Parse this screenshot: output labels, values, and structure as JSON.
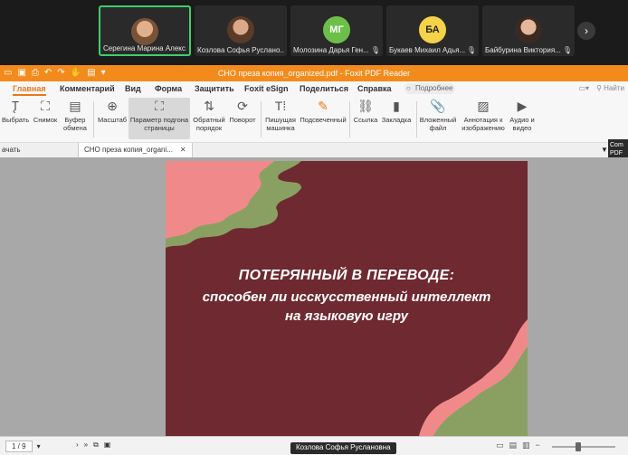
{
  "participants": [
    {
      "name": "Серегина Марина Алекс...",
      "initials": "",
      "avatar_color": "#7a5236",
      "active": true
    },
    {
      "name": "Козлова Софья Руслано...",
      "initials": "",
      "avatar_color": "#5a3b28",
      "active": false
    },
    {
      "name": "Молозина Дарья Ген...",
      "initials": "МГ",
      "avatar_color": "#6cc04a",
      "active": false
    },
    {
      "name": "Букаев Михаил Адья...",
      "initials": "БА",
      "avatar_color": "#f4d24a",
      "active": false
    },
    {
      "name": "Байбурина Виктория...",
      "initials": "",
      "avatar_color": "#3a2a22",
      "active": false
    }
  ],
  "next_icon": "chevron-right",
  "window_title": "СНО преза копия_organized.pdf - Foxit PDF Reader",
  "ribbon_tabs": [
    "Главная",
    "Комментарий",
    "Вид",
    "Форма",
    "Защитить",
    "Foxit eSign",
    "Поделиться",
    "Справка"
  ],
  "search_tip": "Подробнее",
  "find_label": "Найти",
  "tools": [
    {
      "label": "Выбрать",
      "icon": "text-cursor-icon"
    },
    {
      "label": "Снимок",
      "icon": "camera-icon"
    },
    {
      "label": "Буфер обмена",
      "icon": "clipboard-icon"
    },
    {
      "label": "Масштаб",
      "icon": "zoom-icon"
    },
    {
      "label": "Параметр подгона страницы",
      "icon": "fit-page-icon"
    },
    {
      "label": "Обратный порядок",
      "icon": "reverse-order-icon"
    },
    {
      "label": "Поворот",
      "icon": "rotate-icon"
    },
    {
      "label": "Пишущая машинка",
      "icon": "typewriter-icon"
    },
    {
      "label": "Подсвеченный",
      "icon": "highlight-icon"
    },
    {
      "label": "Ссылка",
      "icon": "link-icon"
    },
    {
      "label": "Закладка",
      "icon": "bookmark-icon"
    },
    {
      "label": "Вложенный файл",
      "icon": "attach-file-icon"
    },
    {
      "label": "Аннотация к изображению",
      "icon": "image-annotation-icon"
    },
    {
      "label": "Аудио и видео",
      "icon": "media-icon"
    }
  ],
  "doc_tabs": {
    "start": "ачать",
    "current": "СНО преза копия_organi..."
  },
  "side_note": "Com PDF",
  "slide": {
    "title": "ПОТЕРЯННЫЙ В ПЕРЕВОДЕ:",
    "subtitle": "способен ли исскусственный интеллект на языковую игру",
    "bg": "#6e2a30",
    "pink": "#f08a8a",
    "green": "#8aa063"
  },
  "status": {
    "page": "1 / 9",
    "speaker": "Козлова Софья Руслановна"
  }
}
